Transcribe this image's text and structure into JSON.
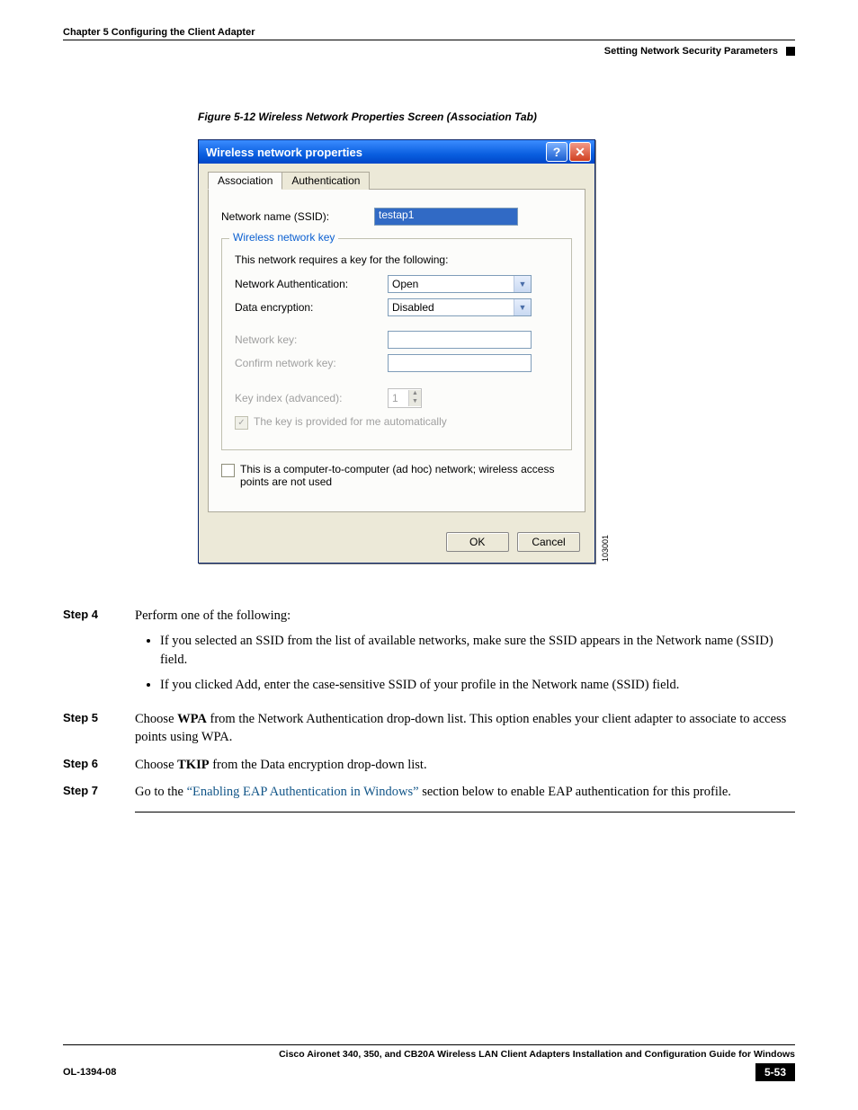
{
  "header": {
    "chapter": "Chapter 5      Configuring the Client Adapter",
    "section": "Setting Network Security Parameters"
  },
  "figure_caption": "Figure 5-12   Wireless Network Properties Screen (Association Tab)",
  "dialog": {
    "title": "Wireless network properties",
    "tabs": {
      "association": "Association",
      "authentication": "Authentication"
    },
    "ssid_label": "Network name (SSID):",
    "ssid_value": "testap1",
    "group_title": "Wireless network key",
    "group_intro": "This network requires a key for the following:",
    "auth_label": "Network Authentication:",
    "auth_value": "Open",
    "enc_label": "Data encryption:",
    "enc_value": "Disabled",
    "netkey_label": "Network key:",
    "confirm_label": "Confirm network key:",
    "keyidx_label": "Key index (advanced):",
    "keyidx_value": "1",
    "auto_label": "The key is provided for me automatically",
    "adhoc_label": "This is a computer-to-computer (ad hoc) network; wireless access points are not used",
    "ok": "OK",
    "cancel": "Cancel",
    "image_id": "103001"
  },
  "steps": {
    "s4": {
      "label": "Step 4",
      "intro": "Perform one of the following:",
      "b1": "If you selected an SSID from the list of available networks, make sure the SSID appears in the Network name (SSID) field.",
      "b2": "If you clicked Add, enter the case-sensitive SSID of your profile in the Network name (SSID) field."
    },
    "s5": {
      "label": "Step 5",
      "t1": "Choose ",
      "bold": "WPA",
      "t2": " from the Network Authentication drop-down list. This option enables your client adapter to associate to access points using WPA."
    },
    "s6": {
      "label": "Step 6",
      "t1": "Choose ",
      "bold": "TKIP",
      "t2": " from the Data encryption drop-down list."
    },
    "s7": {
      "label": "Step 7",
      "t1": "Go to the ",
      "link": "“Enabling EAP Authentication in Windows”",
      "t2": " section below to enable EAP authentication for this profile."
    }
  },
  "footer": {
    "guide": "Cisco Aironet 340, 350, and CB20A Wireless LAN Client Adapters Installation and Configuration Guide for Windows",
    "doc": "OL-1394-08",
    "page": "5-53"
  }
}
